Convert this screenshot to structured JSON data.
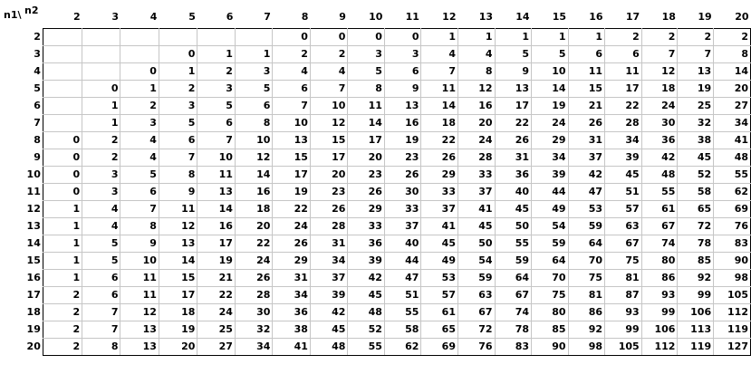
{
  "corner": {
    "row_var": "n1\\",
    "col_var": "n2"
  },
  "columns": [
    "2",
    "3",
    "4",
    "5",
    "6",
    "7",
    "8",
    "9",
    "10",
    "11",
    "12",
    "13",
    "14",
    "15",
    "16",
    "17",
    "18",
    "19",
    "20"
  ],
  "rows": [
    {
      "label": "2",
      "cells": [
        "",
        "",
        "",
        "",
        "",
        "",
        "0",
        "0",
        "0",
        "0",
        "1",
        "1",
        "1",
        "1",
        "1",
        "2",
        "2",
        "2",
        "2"
      ]
    },
    {
      "label": "3",
      "cells": [
        "",
        "",
        "",
        "0",
        "1",
        "1",
        "2",
        "2",
        "3",
        "3",
        "4",
        "4",
        "5",
        "5",
        "6",
        "6",
        "7",
        "7",
        "8"
      ]
    },
    {
      "label": "4",
      "cells": [
        "",
        "",
        "0",
        "1",
        "2",
        "3",
        "4",
        "4",
        "5",
        "6",
        "7",
        "8",
        "9",
        "10",
        "11",
        "11",
        "12",
        "13",
        "14"
      ]
    },
    {
      "label": "5",
      "cells": [
        "",
        "0",
        "1",
        "2",
        "3",
        "5",
        "6",
        "7",
        "8",
        "9",
        "11",
        "12",
        "13",
        "14",
        "15",
        "17",
        "18",
        "19",
        "20"
      ]
    },
    {
      "label": "6",
      "cells": [
        "",
        "1",
        "2",
        "3",
        "5",
        "6",
        "7",
        "10",
        "11",
        "13",
        "14",
        "16",
        "17",
        "19",
        "21",
        "22",
        "24",
        "25",
        "27"
      ]
    },
    {
      "label": "7",
      "cells": [
        "",
        "1",
        "3",
        "5",
        "6",
        "8",
        "10",
        "12",
        "14",
        "16",
        "18",
        "20",
        "22",
        "24",
        "26",
        "28",
        "30",
        "32",
        "34"
      ]
    },
    {
      "label": "8",
      "cells": [
        "0",
        "2",
        "4",
        "6",
        "7",
        "10",
        "13",
        "15",
        "17",
        "19",
        "22",
        "24",
        "26",
        "29",
        "31",
        "34",
        "36",
        "38",
        "41"
      ]
    },
    {
      "label": "9",
      "cells": [
        "0",
        "2",
        "4",
        "7",
        "10",
        "12",
        "15",
        "17",
        "20",
        "23",
        "26",
        "28",
        "31",
        "34",
        "37",
        "39",
        "42",
        "45",
        "48"
      ]
    },
    {
      "label": "10",
      "cells": [
        "0",
        "3",
        "5",
        "8",
        "11",
        "14",
        "17",
        "20",
        "23",
        "26",
        "29",
        "33",
        "36",
        "39",
        "42",
        "45",
        "48",
        "52",
        "55"
      ]
    },
    {
      "label": "11",
      "cells": [
        "0",
        "3",
        "6",
        "9",
        "13",
        "16",
        "19",
        "23",
        "26",
        "30",
        "33",
        "37",
        "40",
        "44",
        "47",
        "51",
        "55",
        "58",
        "62"
      ]
    },
    {
      "label": "12",
      "cells": [
        "1",
        "4",
        "7",
        "11",
        "14",
        "18",
        "22",
        "26",
        "29",
        "33",
        "37",
        "41",
        "45",
        "49",
        "53",
        "57",
        "61",
        "65",
        "69"
      ]
    },
    {
      "label": "13",
      "cells": [
        "1",
        "4",
        "8",
        "12",
        "16",
        "20",
        "24",
        "28",
        "33",
        "37",
        "41",
        "45",
        "50",
        "54",
        "59",
        "63",
        "67",
        "72",
        "76"
      ]
    },
    {
      "label": "14",
      "cells": [
        "1",
        "5",
        "9",
        "13",
        "17",
        "22",
        "26",
        "31",
        "36",
        "40",
        "45",
        "50",
        "55",
        "59",
        "64",
        "67",
        "74",
        "78",
        "83"
      ]
    },
    {
      "label": "15",
      "cells": [
        "1",
        "5",
        "10",
        "14",
        "19",
        "24",
        "29",
        "34",
        "39",
        "44",
        "49",
        "54",
        "59",
        "64",
        "70",
        "75",
        "80",
        "85",
        "90"
      ]
    },
    {
      "label": "16",
      "cells": [
        "1",
        "6",
        "11",
        "15",
        "21",
        "26",
        "31",
        "37",
        "42",
        "47",
        "53",
        "59",
        "64",
        "70",
        "75",
        "81",
        "86",
        "92",
        "98"
      ]
    },
    {
      "label": "17",
      "cells": [
        "2",
        "6",
        "11",
        "17",
        "22",
        "28",
        "34",
        "39",
        "45",
        "51",
        "57",
        "63",
        "67",
        "75",
        "81",
        "87",
        "93",
        "99",
        "105"
      ]
    },
    {
      "label": "18",
      "cells": [
        "2",
        "7",
        "12",
        "18",
        "24",
        "30",
        "36",
        "42",
        "48",
        "55",
        "61",
        "67",
        "74",
        "80",
        "86",
        "93",
        "99",
        "106",
        "112"
      ]
    },
    {
      "label": "19",
      "cells": [
        "2",
        "7",
        "13",
        "19",
        "25",
        "32",
        "38",
        "45",
        "52",
        "58",
        "65",
        "72",
        "78",
        "85",
        "92",
        "99",
        "106",
        "113",
        "119"
      ]
    },
    {
      "label": "20",
      "cells": [
        "2",
        "8",
        "13",
        "20",
        "27",
        "34",
        "41",
        "48",
        "55",
        "62",
        "69",
        "76",
        "83",
        "90",
        "98",
        "105",
        "112",
        "119",
        "127"
      ]
    }
  ]
}
